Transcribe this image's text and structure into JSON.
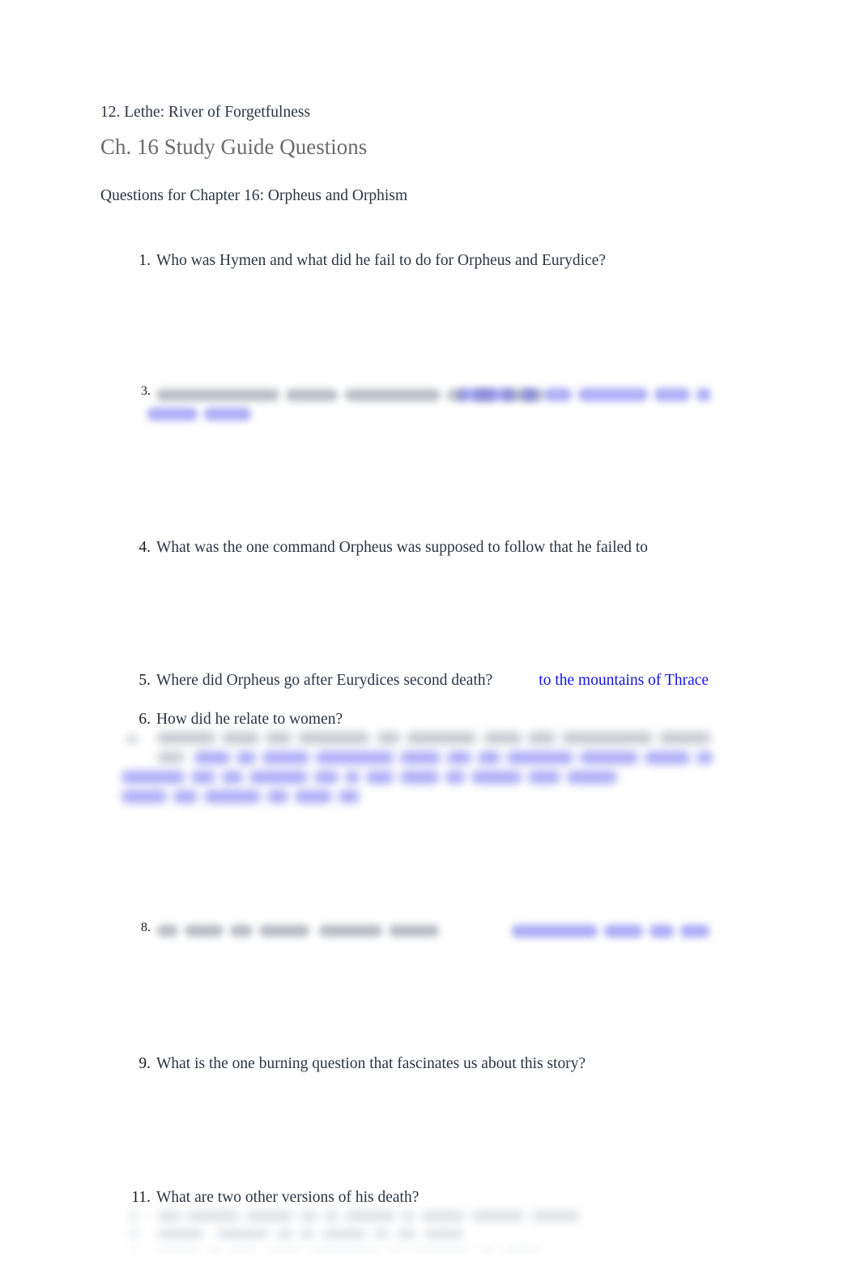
{
  "document": {
    "background_color": "#ffffff",
    "body_text_color": "#2a3542",
    "heading_color": "#6b6b6b",
    "answer_color": "#1414e6",
    "carryover_line": "12. Lethe: River of Forgetfulness",
    "title": "Ch. 16 Study Guide Questions",
    "subtitle": "Questions for Chapter 16: Orpheus and Orphism"
  },
  "questions": [
    {
      "number": "1.",
      "text": "Who was Hymen and what did he fail to do for Orpheus and Eurydice?",
      "answer": "",
      "legible": true
    },
    {
      "number": "3.",
      "text": "",
      "answer": "",
      "legible": false,
      "note": "question and answer blurred / illegible"
    },
    {
      "number": "4.",
      "text": "What was the one command Orpheus was supposed to follow that he failed to",
      "answer": "",
      "legible": true
    },
    {
      "number": "5.",
      "text": "Where did Orpheus go after Eurydices second death?",
      "answer": "to the mountains of Thrace",
      "legible": true
    },
    {
      "number": "6.",
      "text": "How did he relate to women?",
      "answer": "",
      "legible": true
    },
    {
      "number": "7.",
      "text": "",
      "answer": "",
      "legible": false,
      "note": "question line and three answer lines blurred / illegible"
    },
    {
      "number": "8.",
      "text": "",
      "answer": "",
      "legible": false,
      "note": "question and answer blurred / illegible"
    },
    {
      "number": "9.",
      "text": "What is the one burning question that fascinates us about this story?",
      "answer": "",
      "legible": true
    },
    {
      "number": "11.",
      "text": "What are two other versions of his death?",
      "answer": "",
      "legible": true
    }
  ],
  "trailing_blurred_lines": {
    "count": 3,
    "note": "three further numbered lines, blurred and fading off the bottom edge"
  }
}
